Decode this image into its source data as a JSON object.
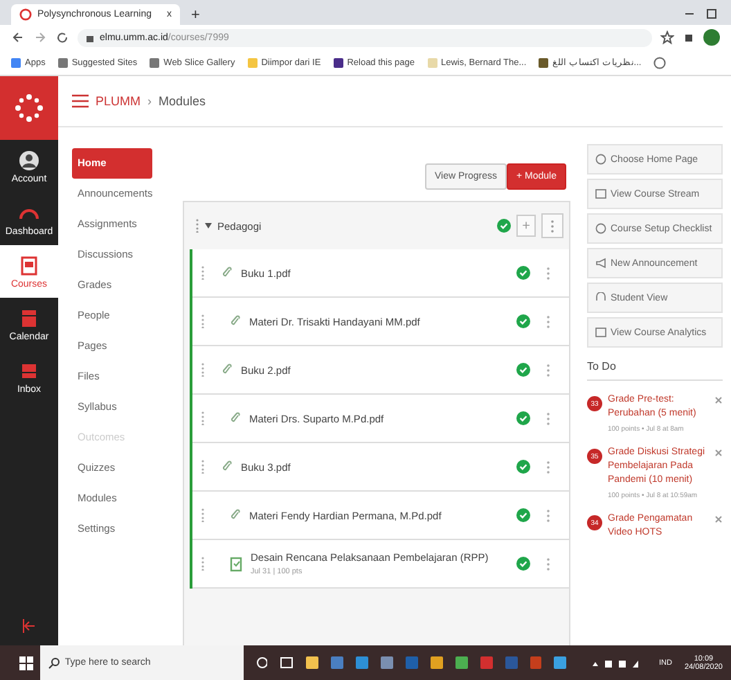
{
  "browser": {
    "tab_title": "Polysynchronous Learning",
    "tab_close": "x",
    "new_tab": "+",
    "url_host": "elmu.umm.ac.id",
    "url_path": "/courses/7999",
    "bookmarks": [
      "Apps",
      "Suggested Sites",
      "Web Slice Gallery",
      "Diimpor dari IE",
      "Reload this page",
      "Lewis, Bernard The...",
      "نظريات اكتساب اللغ..."
    ]
  },
  "global_nav": [
    {
      "label": "Account",
      "kind": "account",
      "selected": false
    },
    {
      "label": "Dashboard",
      "kind": "dashboard",
      "selected": false
    },
    {
      "label": "Courses",
      "kind": "courses",
      "selected": true
    },
    {
      "label": "Calendar",
      "kind": "calendar",
      "selected": false
    },
    {
      "label": "Inbox",
      "kind": "inbox",
      "selected": false
    }
  ],
  "breadcrumb": {
    "course": "PLUMM",
    "separator": "›",
    "page": "Modules"
  },
  "course_nav": [
    {
      "label": "Home",
      "selected": true,
      "disabled": false
    },
    {
      "label": "Announcements",
      "selected": false,
      "disabled": false
    },
    {
      "label": "Assignments",
      "selected": false,
      "disabled": false
    },
    {
      "label": "Discussions",
      "selected": false,
      "disabled": false
    },
    {
      "label": "Grades",
      "selected": false,
      "disabled": false
    },
    {
      "label": "People",
      "selected": false,
      "disabled": false
    },
    {
      "label": "Pages",
      "selected": false,
      "disabled": false
    },
    {
      "label": "Files",
      "selected": false,
      "disabled": false
    },
    {
      "label": "Syllabus",
      "selected": false,
      "disabled": false
    },
    {
      "label": "Outcomes",
      "selected": false,
      "disabled": true
    },
    {
      "label": "Quizzes",
      "selected": false,
      "disabled": false
    },
    {
      "label": "Modules",
      "selected": false,
      "disabled": false
    },
    {
      "label": "Settings",
      "selected": false,
      "disabled": false
    }
  ],
  "toolbar": {
    "view_progress": "View Progress",
    "add_module": "+ Module"
  },
  "module": {
    "title": "Pedagogi",
    "published": true,
    "add": "+",
    "items": [
      {
        "name": "Buku 1.pdf",
        "kind": "file",
        "indented": false,
        "published": true
      },
      {
        "name": "Materi Dr. Trisakti Handayani MM.pdf",
        "kind": "file",
        "indented": true,
        "published": true
      },
      {
        "name": "Buku 2.pdf",
        "kind": "file",
        "indented": false,
        "published": true
      },
      {
        "name": "Materi Drs. Suparto M.Pd.pdf",
        "kind": "file",
        "indented": true,
        "published": true
      },
      {
        "name": "Buku 3.pdf",
        "kind": "file",
        "indented": false,
        "published": true
      },
      {
        "name": "Materi Fendy Hardian Permana, M.Pd.pdf",
        "kind": "file",
        "indented": true,
        "published": true
      },
      {
        "name": "Desain Rencana Pelaksanaan Pembelajaran (RPP)",
        "meta": "Jul 31 | 100 pts",
        "kind": "assignment",
        "indented": true,
        "published": true
      }
    ]
  },
  "sidebar_buttons": [
    {
      "label": "Choose Home Page",
      "kind": "home"
    },
    {
      "label": "View Course Stream",
      "kind": "stream"
    },
    {
      "label": "Course Setup Checklist",
      "kind": "checklist"
    },
    {
      "label": "New Announcement",
      "kind": "announce"
    },
    {
      "label": "Student View",
      "kind": "student"
    },
    {
      "label": "View Course Analytics",
      "kind": "analytics"
    }
  ],
  "todo": {
    "title": "To Do",
    "items": [
      {
        "badge": "33",
        "title": "Grade Pre-test: Perubahan (5 menit)",
        "meta": "100 points • Jul 8 at 8am"
      },
      {
        "badge": "35",
        "title": "Grade Diskusi Strategi Pembelajaran Pada Pandemi (10 menit)",
        "meta": "100 points • Jul 8 at 10:59am"
      },
      {
        "badge": "34",
        "title": "Grade Pengamatan Video HOTS"
      }
    ]
  },
  "taskbar": {
    "search_placeholder": "Type here to search",
    "apps": [
      {
        "color": "#f2c14e"
      },
      {
        "color": "#4a7fc1"
      },
      {
        "color": "#2d8fd5"
      },
      {
        "color": "#7a8fb0"
      },
      {
        "color": "#1f5fa8"
      },
      {
        "color": "#e0a020"
      },
      {
        "color": "#4caf50"
      },
      {
        "color": "#d32f2f"
      },
      {
        "color": "#2b579a"
      },
      {
        "color": "#c43e1c"
      },
      {
        "color": "#3aa0e0"
      }
    ],
    "language": "IND",
    "time": "10:09",
    "date": "24/08/2020"
  }
}
